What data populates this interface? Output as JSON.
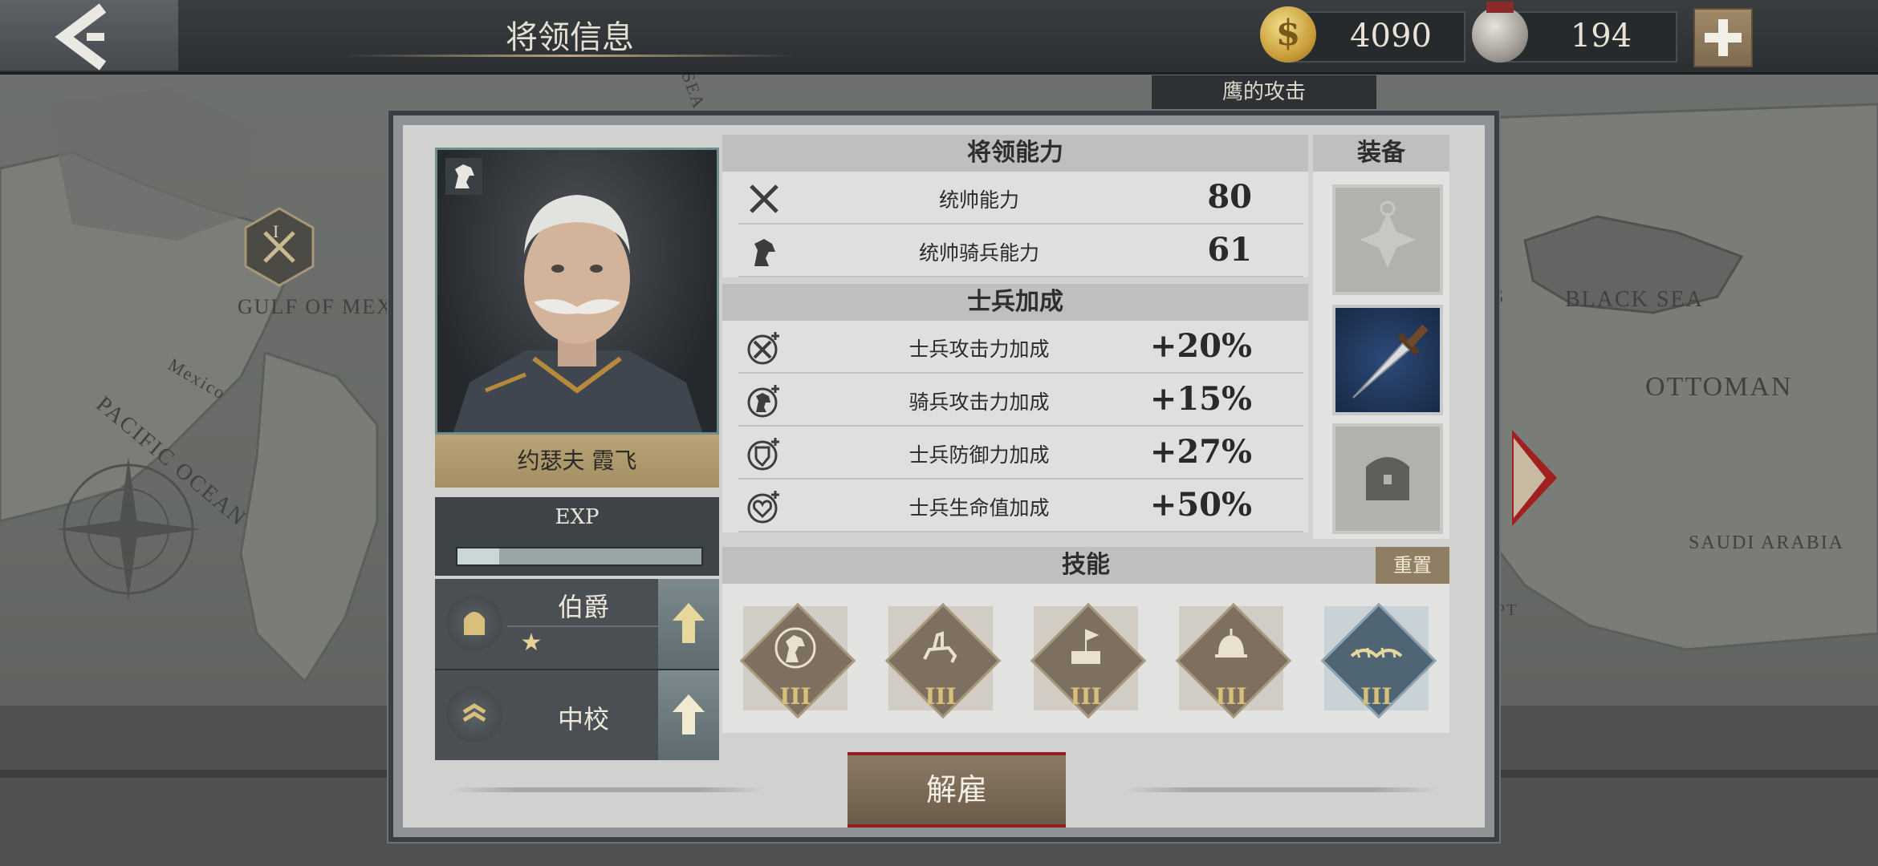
{
  "header": {
    "title": "将领信息",
    "gold": "4090",
    "medals": "194",
    "event_tag": "鹰的攻击"
  },
  "map": {
    "labels": [
      "GULF OF MEXICO",
      "Mexico",
      "PACIFIC OCEAN",
      "BLACK SEA",
      "OTTOMAN",
      "SAUDI ARABIA",
      "S",
      "PT",
      "SEA"
    ],
    "level_badge": "I"
  },
  "general": {
    "name": "约瑟夫 霞飞",
    "exp_label": "EXP",
    "exp_progress": 0.17,
    "noble_rank": "伯爵",
    "noble_stars": "★",
    "military_rank": "中校"
  },
  "ability": {
    "header": "将领能力",
    "rows": [
      {
        "label": "统帅能力",
        "value": "80",
        "icon": "crossed-swords-icon"
      },
      {
        "label": "统帅骑兵能力",
        "value": "61",
        "icon": "horse-head-icon"
      }
    ]
  },
  "bonus": {
    "header": "士兵加成",
    "rows": [
      {
        "label": "士兵攻击力加成",
        "value": "+20%",
        "icon": "attack-plus-icon"
      },
      {
        "label": "骑兵攻击力加成",
        "value": "+15%",
        "icon": "cavalry-plus-icon"
      },
      {
        "label": "士兵防御力加成",
        "value": "+27%",
        "icon": "shield-plus-icon"
      },
      {
        "label": "士兵生命值加成",
        "value": "+50%",
        "icon": "heart-plus-icon"
      }
    ]
  },
  "equipment": {
    "header": "装备",
    "slots": [
      "medal-slot-icon",
      "dagger-icon",
      "chest-icon"
    ]
  },
  "skills": {
    "header": "技能",
    "reset_label": "重置",
    "items": [
      {
        "icon": "knight-emblem-icon",
        "level": "III"
      },
      {
        "icon": "cavalry-rider-icon",
        "level": "III"
      },
      {
        "icon": "fort-flag-icon",
        "level": "III"
      },
      {
        "icon": "infantry-helmet-icon",
        "level": "III"
      },
      {
        "icon": "barbed-wire-icon",
        "level": "III"
      }
    ]
  },
  "footer": {
    "dismiss_label": "解雇"
  },
  "colors": {
    "gold_accent": "#b9a476",
    "reset_button": "#8f7e64",
    "dismiss_border": "#8e2020",
    "skill_level": "#d9c07a"
  }
}
